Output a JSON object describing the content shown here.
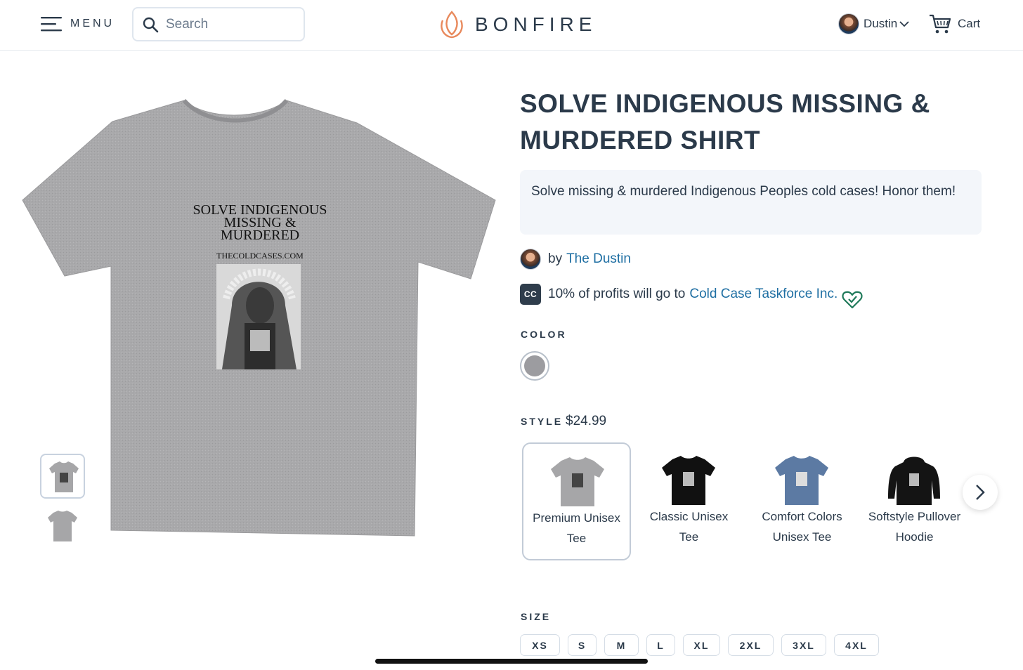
{
  "header": {
    "menu_label": "MENU",
    "search_placeholder": "Search",
    "logo_text": "BONFIRE",
    "user_name": "Dustin",
    "cart_label": "Cart"
  },
  "product": {
    "title": "SOLVE INDIGENOUS MISSING & MURDERED SHIRT",
    "description": "Solve missing & murdered Indigenous Peoples cold cases! Honor them!",
    "by_label": "by",
    "creator": "The Dustin",
    "cause_text": "10% of profits will go to",
    "cause_org": "Cold Case Taskforce Inc.",
    "cause_badge": "CC",
    "shirt_print": {
      "line1": "SOLVE INDIGENOUS",
      "line2": "MISSING &",
      "line3": "MURDERED",
      "site": "THECOLDCASES.COM"
    }
  },
  "color": {
    "label": "COLOR",
    "selected": "#9c9ca0"
  },
  "style": {
    "label": "STYLE",
    "price": "$24.99",
    "options": [
      {
        "name": "Premium Unisex Tee",
        "color": "#a6a6a8",
        "selected": true
      },
      {
        "name": "Classic Unisex Tee",
        "color": "#111111",
        "selected": false
      },
      {
        "name": "Comfort Colors Unisex Tee",
        "color": "#5c7aa3",
        "selected": false
      },
      {
        "name": "Softstyle Pullover Hoodie",
        "color": "#141414",
        "selected": false
      }
    ]
  },
  "size": {
    "label": "SIZE",
    "options": [
      "XS",
      "S",
      "M",
      "L",
      "XL",
      "2XL",
      "3XL",
      "4XL"
    ]
  },
  "colors": {
    "link": "#1f6fa3",
    "text": "#2b3a4a",
    "logo_accent": "#e8895c",
    "heart": "#1f7a5a"
  }
}
